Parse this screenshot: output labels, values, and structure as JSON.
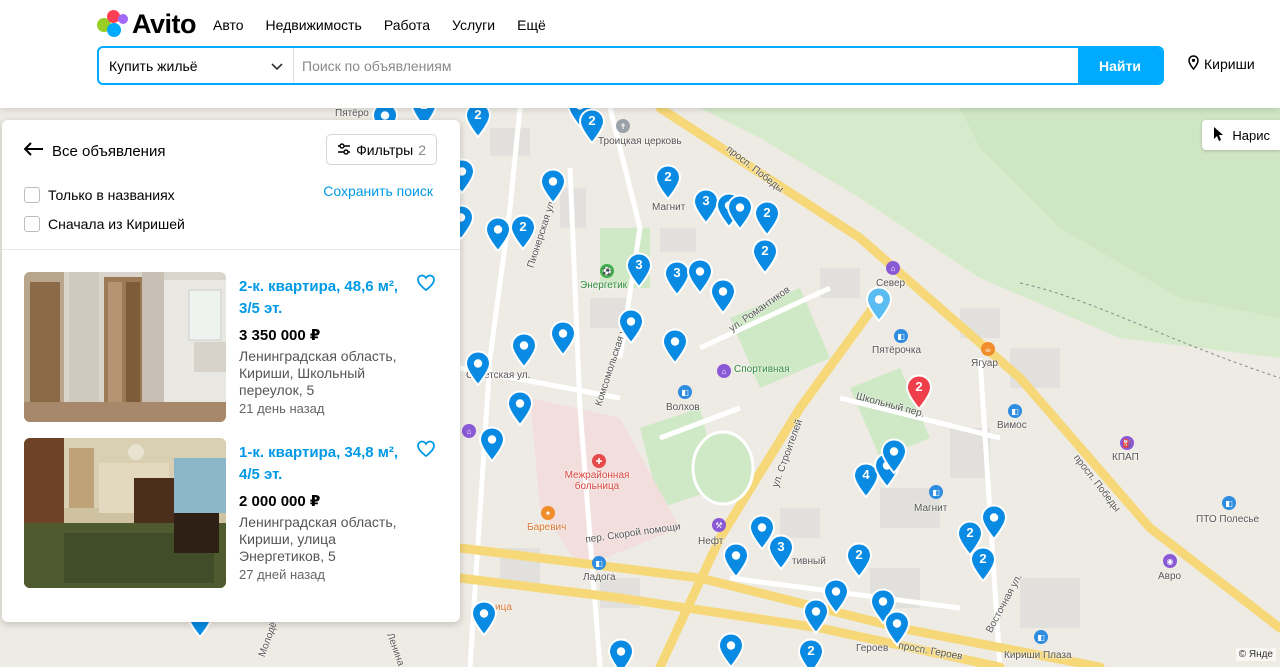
{
  "header": {
    "logo": "Avito",
    "nav": [
      "Авто",
      "Недвижимость",
      "Работа",
      "Услуги",
      "Ещё"
    ],
    "category": "Купить жильё",
    "search_placeholder": "Поиск по объявлениям",
    "find_label": "Найти",
    "location": "Кириши"
  },
  "panel": {
    "back_label": "Все объявления",
    "filters_label": "Фильтры",
    "filters_count": "2",
    "only_titles_label": "Только в названиях",
    "kirishi_first_label": "Сначала из Киришей",
    "save_search_label": "Сохранить поиск",
    "listings": [
      {
        "title": "2-к. квартира, 48,6 м², 3/5 эт.",
        "price": "3 350 000 ₽",
        "address": "Ленинградская область, Кириши, Школьный переулок, 5",
        "date": "21 день назад"
      },
      {
        "title": "1-к. квартира, 34,8 м², 4/5 эт.",
        "price": "2 000 000 ₽",
        "address": "Ленинградская область, Кириши, улица Энергетиков, 5",
        "date": "27 дней назад"
      }
    ]
  },
  "map": {
    "cursor_label": "Нарис",
    "copyright": "© Янде",
    "labels": {
      "troitskaya": "Троицкая церковь",
      "magnit1": "Магнит",
      "energetik": "Энергетик",
      "sever": "Север",
      "pyaterochka1": "Пятёрочка",
      "pyaterochka2": "Пятёро",
      "yaguar": "Ягуар",
      "sportivnaya": "Спортивная",
      "volkhov": "Волхов",
      "vimos": "Вимос",
      "kpap": "КПАП",
      "hospital": "Межрайонная больница",
      "barevich": "Баревич",
      "ladoga": "Ладога",
      "neft": "Нефт",
      "magnit2": "Магнит",
      "pto": "ПТО Полесье",
      "avro": "Авро",
      "kirishi_plaza": "Кириши Плаза",
      "pr_pobedy1": "просп. Победы",
      "pr_pobedy2": "просп. Победы",
      "ul_romantikov": "ул. Романтиков",
      "ul_stroiteley": "ул. Строителей",
      "komsomolskaya": "Комсомольская ул.",
      "sovetskaya": "Советская ул.",
      "shkolny": "Школьный пер.",
      "skoroy": "пер. Скорой помощи",
      "vostochnaya": "Восточная ул.",
      "pr_geroev": "просп. Героев",
      "geroev": "Героев",
      "pionerskaya": "Пионерская ул.",
      "lenina": "Ленина",
      "molod": "Молодё",
      "tsa": "ица",
      "tivny": "тивный"
    },
    "pins": [
      {
        "n": "2"
      },
      {
        "n": "2"
      },
      {
        "n": ""
      },
      {
        "n": ""
      },
      {
        "n": "2"
      },
      {
        "n": "3"
      },
      {
        "n": ""
      },
      {
        "n": "2"
      },
      {
        "n": ""
      },
      {
        "n": ""
      },
      {
        "n": "2"
      },
      {
        "n": "3"
      },
      {
        "n": "3"
      },
      {
        "n": ""
      },
      {
        "n": ""
      },
      {
        "n": ""
      },
      {
        "n": ""
      },
      {
        "n": ""
      },
      {
        "n": ""
      },
      {
        "n": ""
      },
      {
        "n": ""
      },
      {
        "n": ""
      },
      {
        "n": ""
      },
      {
        "n": "2"
      },
      {
        "n": "2"
      },
      {
        "n": "4"
      },
      {
        "n": ""
      },
      {
        "n": ""
      },
      {
        "n": "2"
      },
      {
        "n": "2"
      },
      {
        "n": ""
      },
      {
        "n": "3"
      },
      {
        "n": ""
      },
      {
        "n": "2"
      },
      {
        "n": ""
      },
      {
        "n": ""
      },
      {
        "n": ""
      },
      {
        "n": ""
      },
      {
        "n": ""
      },
      {
        "n": "2"
      },
      {
        "n": ""
      },
      {
        "n": ""
      },
      {
        "n": ""
      },
      {
        "n": ""
      },
      {
        "n": ""
      },
      {
        "n": ""
      }
    ],
    "colors": {
      "pin": "#0a8be3",
      "pin_selected": "#ef3f4a",
      "pin_light": "#5bbcf2",
      "road_major": "#f6d879",
      "park": "#cfe8c6",
      "water": "#cbe3c0"
    }
  }
}
